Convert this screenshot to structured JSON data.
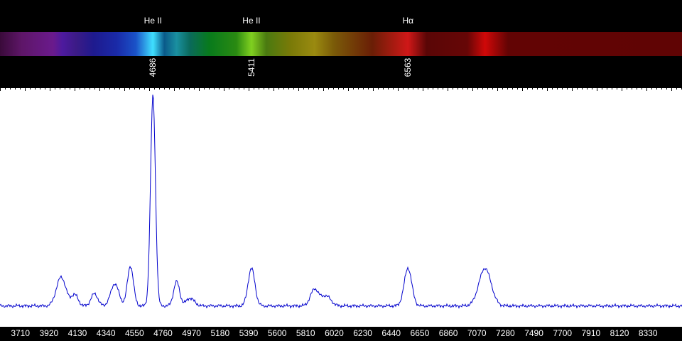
{
  "chart_data": {
    "type": "line",
    "title": "",
    "xlabel": "",
    "ylabel": "",
    "xlim": [
      3560,
      8580
    ],
    "ylim": [
      0,
      1
    ],
    "x_ticks": [
      3710,
      3920,
      4130,
      4340,
      4550,
      4760,
      4970,
      5180,
      5390,
      5600,
      5810,
      6020,
      6230,
      6440,
      6650,
      6860,
      7070,
      7280,
      7490,
      7700,
      7910,
      8120,
      8330
    ],
    "lines": [
      {
        "name": "He II",
        "wavelength": "4686"
      },
      {
        "name": "He II",
        "wavelength": "5411"
      },
      {
        "name": "Hα",
        "wavelength": "6563"
      }
    ],
    "series": [
      {
        "color": "#0000cc",
        "continuum": 0.075,
        "peaks": [
          {
            "x": 4010,
            "height": 0.13,
            "width": 35
          },
          {
            "x": 4110,
            "height": 0.05,
            "width": 25
          },
          {
            "x": 4255,
            "height": 0.055,
            "width": 25
          },
          {
            "x": 4405,
            "height": 0.1,
            "width": 30
          },
          {
            "x": 4520,
            "height": 0.18,
            "width": 22
          },
          {
            "x": 4686,
            "height": 0.95,
            "width": 18
          },
          {
            "x": 4860,
            "height": 0.11,
            "width": 22
          },
          {
            "x": 4960,
            "height": 0.035,
            "width": 30
          },
          {
            "x": 5411,
            "height": 0.17,
            "width": 25
          },
          {
            "x": 5875,
            "height": 0.075,
            "width": 30
          },
          {
            "x": 5960,
            "height": 0.045,
            "width": 35
          },
          {
            "x": 6563,
            "height": 0.17,
            "width": 28
          },
          {
            "x": 7130,
            "height": 0.17,
            "width": 45
          }
        ]
      }
    ]
  },
  "spectrum_colors": [
    {
      "wl": 3560,
      "color": "#3a0a3a"
    },
    {
      "wl": 3720,
      "color": "#5e1668"
    },
    {
      "wl": 3950,
      "color": "#6a1a8c"
    },
    {
      "wl": 4020,
      "color": "#4d1a9e"
    },
    {
      "wl": 4120,
      "color": "#3c1b86"
    },
    {
      "wl": 4250,
      "color": "#1e1a8e"
    },
    {
      "wl": 4420,
      "color": "#1a2aa8"
    },
    {
      "wl": 4560,
      "color": "#1a52c8"
    },
    {
      "wl": 4686,
      "color": "#40e0ff"
    },
    {
      "wl": 4770,
      "color": "#0a5a8a"
    },
    {
      "wl": 4860,
      "color": "#1a90a0"
    },
    {
      "wl": 4960,
      "color": "#0a6a5a"
    },
    {
      "wl": 5100,
      "color": "#087a1c"
    },
    {
      "wl": 5300,
      "color": "#2a8a12"
    },
    {
      "wl": 5411,
      "color": "#80d020"
    },
    {
      "wl": 5520,
      "color": "#4a7a10"
    },
    {
      "wl": 5700,
      "color": "#7a7a08"
    },
    {
      "wl": 5875,
      "color": "#9a8a10"
    },
    {
      "wl": 6020,
      "color": "#7a5a08"
    },
    {
      "wl": 6300,
      "color": "#6a1e06"
    },
    {
      "wl": 6563,
      "color": "#d01818"
    },
    {
      "wl": 6700,
      "color": "#5a0606"
    },
    {
      "wl": 7000,
      "color": "#660606"
    },
    {
      "wl": 7130,
      "color": "#d00808"
    },
    {
      "wl": 7300,
      "color": "#620404"
    },
    {
      "wl": 8580,
      "color": "#600404"
    }
  ]
}
